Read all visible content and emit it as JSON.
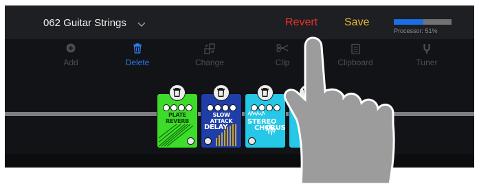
{
  "header": {
    "preset_name": "062 Guitar Strings",
    "revert_label": "Revert",
    "save_label": "Save",
    "processor_label": "Processor: 51%",
    "processor_value": 0.51
  },
  "toolbar": {
    "add": "Add",
    "delete": "Delete",
    "change": "Change",
    "clip": "Clip",
    "clipboard": "Clipboard",
    "tuner": "Tuner"
  },
  "pedals": [
    {
      "name_line1": "PLATE",
      "name_line2": "REVERB",
      "color": "#3ddc2a"
    },
    {
      "name_line1": "SLOW ATTACK",
      "name_line2": "DELAY",
      "color": "#1f3ea8"
    },
    {
      "name_line1": "STEREO",
      "name_line2": "CHORUS",
      "color": "#25c8e6"
    }
  ],
  "colors": {
    "accent": "#2e7bf0",
    "revert": "#e8322c",
    "save": "#e8b63a",
    "background": "#111316"
  }
}
